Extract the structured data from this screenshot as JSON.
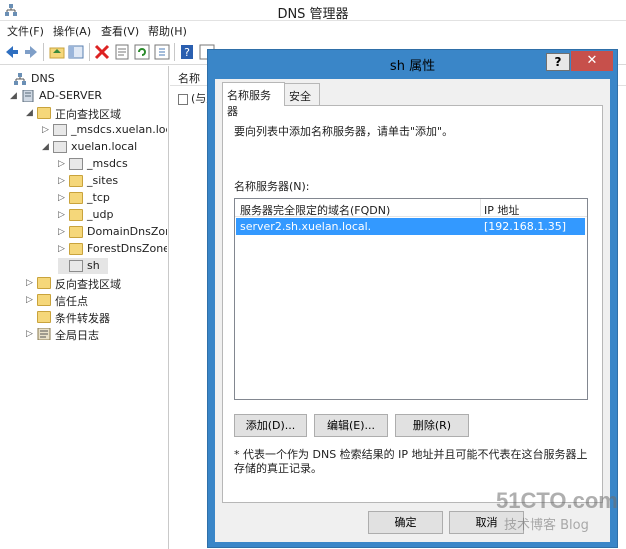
{
  "window": {
    "title": "DNS 管理器"
  },
  "menu": [
    "文件(F)",
    "操作(A)",
    "查看(V)",
    "帮助(H)"
  ],
  "tree": [
    {
      "label": "DNS",
      "level": 0,
      "expander": "",
      "icon": "dns-icon"
    },
    {
      "label": "AD-SERVER",
      "level": 1,
      "expander": "◢",
      "icon": "server-icon"
    },
    {
      "label": "正向查找区域",
      "level": 2,
      "expander": "◢",
      "icon": "folder-icon"
    },
    {
      "label": "_msdcs.xuelan.local",
      "level": 3,
      "expander": "▷",
      "icon": "zone-icon"
    },
    {
      "label": "xuelan.local",
      "level": 3,
      "expander": "◢",
      "icon": "zone-icon"
    },
    {
      "label": "_msdcs",
      "level": 4,
      "expander": "▷",
      "icon": "zone-icon"
    },
    {
      "label": "_sites",
      "level": 4,
      "expander": "▷",
      "icon": "folder-icon"
    },
    {
      "label": "_tcp",
      "level": 4,
      "expander": "▷",
      "icon": "folder-icon"
    },
    {
      "label": "_udp",
      "level": 4,
      "expander": "▷",
      "icon": "folder-icon"
    },
    {
      "label": "DomainDnsZones",
      "level": 4,
      "expander": "▷",
      "icon": "folder-icon"
    },
    {
      "label": "ForestDnsZones",
      "level": 4,
      "expander": "▷",
      "icon": "folder-icon"
    },
    {
      "label": "sh",
      "level": 4,
      "expander": "",
      "icon": "zone-icon",
      "selected": true
    },
    {
      "label": "反向查找区域",
      "level": 2,
      "expander": "▷",
      "icon": "folder-icon"
    },
    {
      "label": "信任点",
      "level": 2,
      "expander": "▷",
      "icon": "folder-icon"
    },
    {
      "label": "条件转发器",
      "level": 2,
      "expander": "",
      "icon": "folder-icon"
    },
    {
      "label": "全局日志",
      "level": 2,
      "expander": "▷",
      "icon": "log-icon"
    }
  ],
  "list": {
    "column_name": "名称",
    "row_text": "(与父"
  },
  "dialog": {
    "title": "sh 属性",
    "help": "?",
    "close": "✕",
    "tabs": [
      "名称服务器",
      "安全"
    ],
    "instruction": "要向列表中添加名称服务器，请单击\"添加\"。",
    "ns_label": "名称服务器(N):",
    "table": {
      "headers": [
        "服务器完全限定的域名(FQDN)",
        "IP 地址"
      ],
      "rows": [
        {
          "fqdn": "server2.sh.xuelan.local.",
          "ip": "[192.168.1.35]"
        }
      ]
    },
    "buttons": {
      "add": "添加(D)...",
      "edit": "编辑(E)...",
      "remove": "删除(R)"
    },
    "footnote": "* 代表一个作为 DNS 检索结果的 IP 地址并且可能不代表在这台服务器上存储的真正记录。",
    "ok": "确定",
    "cancel": "取消"
  },
  "watermark": {
    "main": "51CTO.com",
    "sub": "技术博客 Blog"
  }
}
